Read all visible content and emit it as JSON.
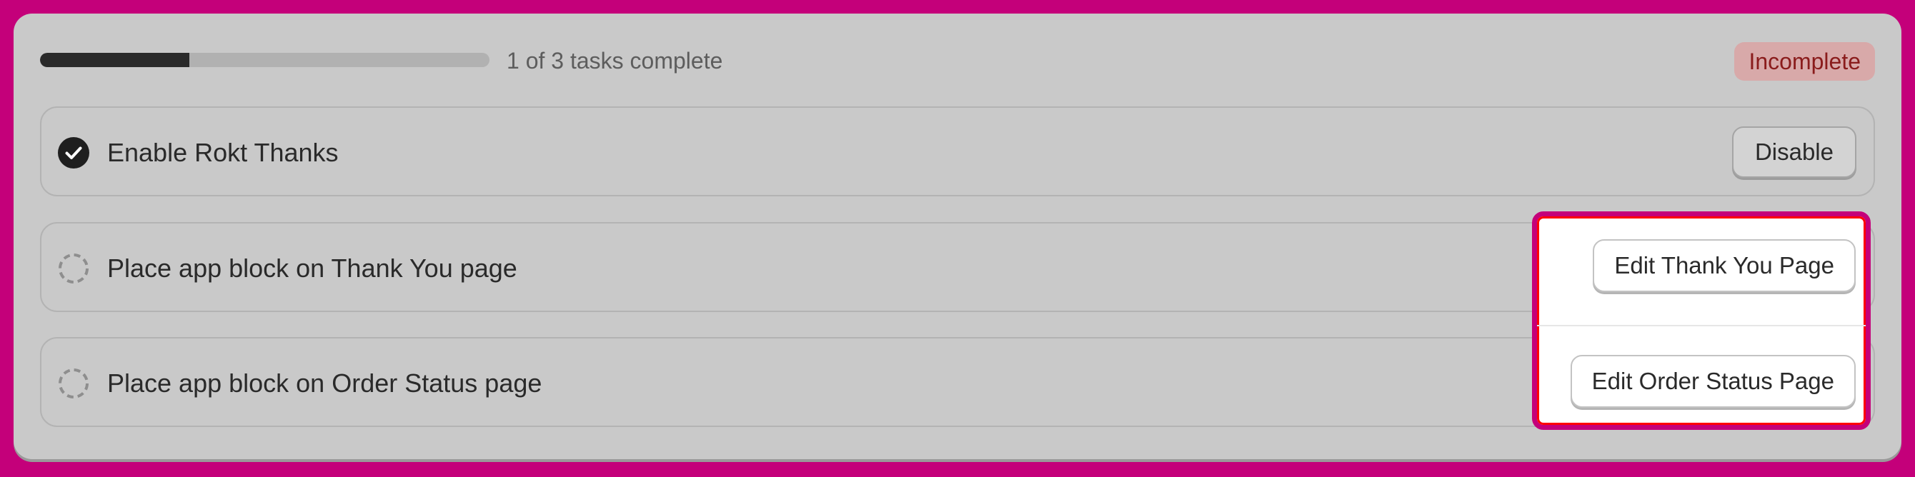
{
  "progress": {
    "text": "1 of 3 tasks complete",
    "completed": 1,
    "total": 3,
    "fraction": 0.333
  },
  "status_badge": "Incomplete",
  "tasks": [
    {
      "label": "Enable Rokt Thanks",
      "button": "Disable",
      "done": true
    },
    {
      "label": "Place app block on Thank You page",
      "button": "Edit Thank You Page",
      "done": false
    },
    {
      "label": "Place app block on Order Status page",
      "button": "Edit Order Status Page",
      "done": false
    }
  ],
  "icons": {
    "done": "check-circle-icon",
    "pending": "dashed-circle-icon"
  },
  "colors": {
    "highlight_border": "#c4007a",
    "highlight_outline": "#ff0000",
    "badge_bg": "#d8a9a9",
    "badge_text": "#8a1c1c"
  }
}
